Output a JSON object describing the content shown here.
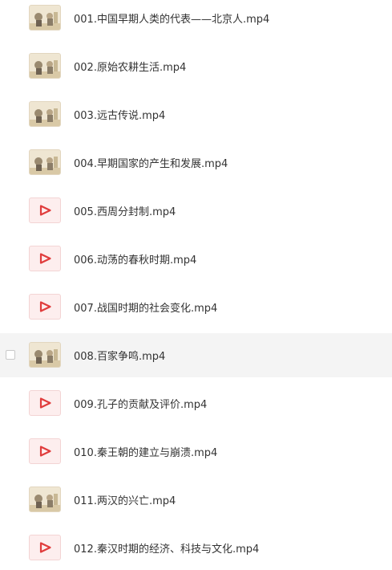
{
  "files": [
    {
      "name": "001.中国早期人类的代表——北京人.mp4",
      "thumb": "image"
    },
    {
      "name": "002.原始农耕生活.mp4",
      "thumb": "image"
    },
    {
      "name": "003.远古传说.mp4",
      "thumb": "image"
    },
    {
      "name": "004.早期国家的产生和发展.mp4",
      "thumb": "image"
    },
    {
      "name": "005.西周分封制.mp4",
      "thumb": "video"
    },
    {
      "name": "006.动荡的春秋时期.mp4",
      "thumb": "video"
    },
    {
      "name": "007.战国时期的社会变化.mp4",
      "thumb": "video"
    },
    {
      "name": "008.百家争鸣.mp4",
      "thumb": "image"
    },
    {
      "name": "009.孔子的贡献及评价.mp4",
      "thumb": "video"
    },
    {
      "name": "010.秦王朝的建立与崩溃.mp4",
      "thumb": "video"
    },
    {
      "name": "011.两汉的兴亡.mp4",
      "thumb": "image"
    },
    {
      "name": "012.秦汉时期的经济、科技与文化.mp4",
      "thumb": "video"
    }
  ],
  "hovered_index": 7,
  "icons": {
    "video": "play-icon",
    "image": "thumbnail"
  },
  "colors": {
    "play": "#e03c3c",
    "hover_bg": "#f4f4f4",
    "text": "#333333"
  }
}
